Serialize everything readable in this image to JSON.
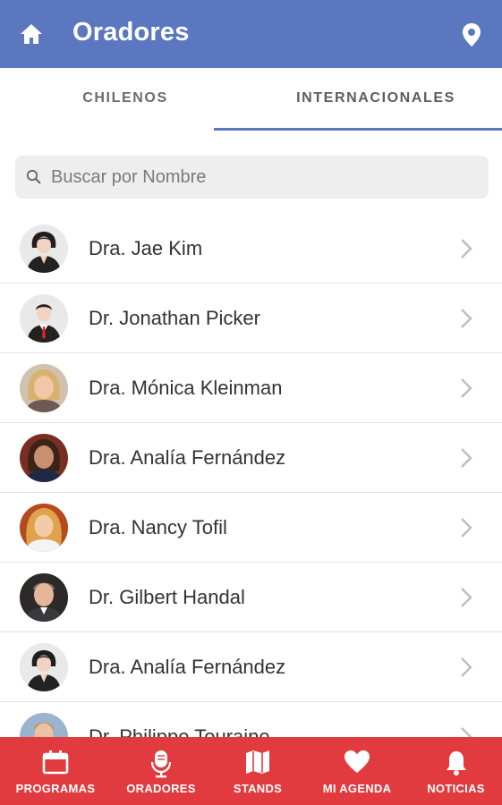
{
  "header": {
    "title": "Oradores",
    "home_icon": "home-icon",
    "location_icon": "location-pin-icon",
    "color": "#5b77bf"
  },
  "tabs": [
    {
      "label": "CHILENOS",
      "active": false
    },
    {
      "label": "INTERNACIONALES",
      "active": true
    }
  ],
  "search": {
    "placeholder": "Buscar por Nombre",
    "value": "",
    "icon": "search-icon"
  },
  "speakers": [
    {
      "name": "Dra. Jae Kim",
      "avatar": "female-placeholder"
    },
    {
      "name": "Dr. Jonathan Picker",
      "avatar": "male-placeholder"
    },
    {
      "name": "Dra. Mónica Kleinman",
      "avatar": "photo"
    },
    {
      "name": "Dra. Analía Fernández",
      "avatar": "photo"
    },
    {
      "name": "Dra. Nancy Tofil",
      "avatar": "photo"
    },
    {
      "name": "Dr. Gilbert Handal",
      "avatar": "photo"
    },
    {
      "name": "Dra. Analía Fernández",
      "avatar": "female-placeholder"
    },
    {
      "name": "Dr. Philippe Touraine",
      "avatar": "photo"
    }
  ],
  "bottom_nav": {
    "color": "#e23b3f",
    "items": [
      {
        "label": "PROGRAMAS",
        "icon": "calendar-icon"
      },
      {
        "label": "ORADORES",
        "icon": "microphone-icon"
      },
      {
        "label": "STANDS",
        "icon": "map-icon"
      },
      {
        "label": "MI AGENDA",
        "icon": "heart-icon"
      },
      {
        "label": "NOTICIAS",
        "icon": "bell-icon"
      }
    ]
  }
}
